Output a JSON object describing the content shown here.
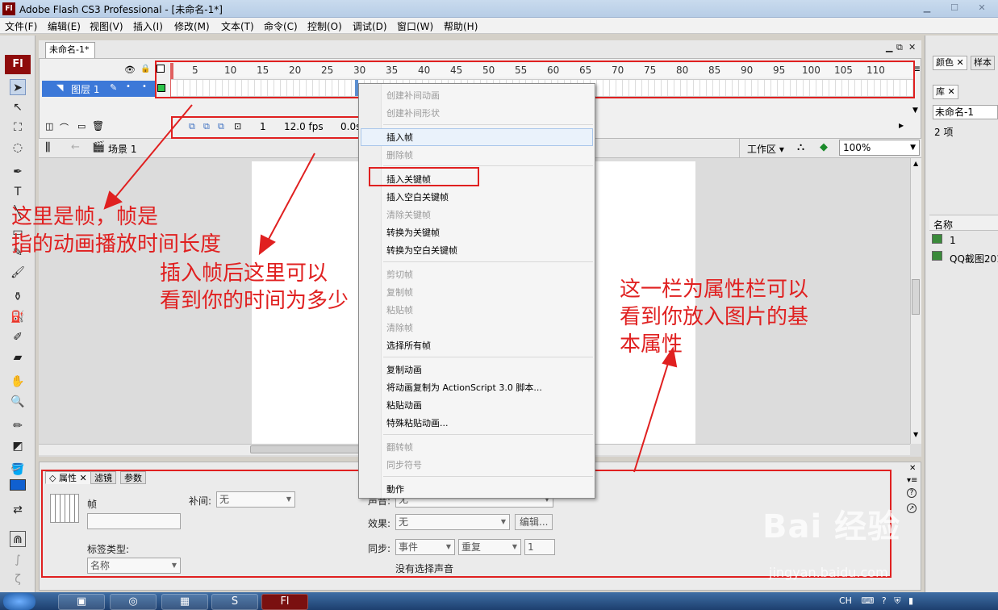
{
  "window": {
    "app_icon": "Fl",
    "title": "Adobe Flash CS3 Professional - [未命名-1*]"
  },
  "menu": [
    "文件(F)",
    "编辑(E)",
    "视图(V)",
    "插入(I)",
    "修改(M)",
    "文本(T)",
    "命令(C)",
    "控制(O)",
    "调试(D)",
    "窗口(W)",
    "帮助(H)"
  ],
  "document_tab": "未命名-1*",
  "timeline": {
    "layer_name": "图层 1",
    "ruler_ticks": [
      "5",
      "10",
      "15",
      "20",
      "25",
      "30",
      "35",
      "40",
      "45",
      "50",
      "55",
      "60",
      "65",
      "70",
      "75",
      "80",
      "85",
      "90",
      "95",
      "100",
      "105",
      "110"
    ],
    "current_frame": "1",
    "fps": "12.0 fps",
    "elapsed": "0.0s"
  },
  "scene": {
    "label": "场景 1",
    "workspace": "工作区",
    "zoom": "100%"
  },
  "properties": {
    "tabs": [
      "属性",
      "滤镜",
      "参数"
    ],
    "frame_label": "帧",
    "tween_label": "补间:",
    "tween_value": "无",
    "label_type_label": "标签类型:",
    "label_type_value": "名称",
    "sound_label": "声音:",
    "sound_value": "无",
    "effect_label": "效果:",
    "effect_value": "无",
    "edit_button": "编辑...",
    "sync_label": "同步:",
    "sync_value": "事件",
    "repeat_value": "重复",
    "repeat_count": "1",
    "no_sound": "没有选择声音"
  },
  "right_panel": {
    "tabs": [
      "颜色",
      "样本"
    ],
    "library_tab": "库",
    "library_doc": "未命名-1",
    "item_count": "2 项",
    "name_header": "名称",
    "items": [
      "1",
      "QQ截图201"
    ]
  },
  "context_menu": [
    {
      "label": "创建补间动画",
      "disabled": true
    },
    {
      "label": "创建补间形状",
      "disabled": true
    },
    {
      "label": "插入帧",
      "disabled": false
    },
    {
      "label": "删除帧",
      "disabled": true
    },
    {
      "label": "插入关键帧",
      "disabled": false
    },
    {
      "label": "插入空白关键帧",
      "disabled": false
    },
    {
      "label": "清除关键帧",
      "disabled": true
    },
    {
      "label": "转换为关键帧",
      "disabled": false
    },
    {
      "label": "转换为空白关键帧",
      "disabled": false
    },
    {
      "label": "剪切帧",
      "disabled": true
    },
    {
      "label": "复制帧",
      "disabled": true
    },
    {
      "label": "粘贴帧",
      "disabled": true
    },
    {
      "label": "清除帧",
      "disabled": true
    },
    {
      "label": "选择所有帧",
      "disabled": false
    },
    {
      "label": "复制动画",
      "disabled": false
    },
    {
      "label": "将动画复制为 ActionScript 3.0 脚本...",
      "disabled": false
    },
    {
      "label": "粘贴动画",
      "disabled": false
    },
    {
      "label": "特殊粘贴动画...",
      "disabled": false
    },
    {
      "label": "翻转帧",
      "disabled": true
    },
    {
      "label": "同步符号",
      "disabled": true
    },
    {
      "label": "動作",
      "disabled": false
    }
  ],
  "annotations": {
    "frames_note": "这里是帧，帧是\n指的动画播放时间长度",
    "time_note": "插入帧后这里可以\n看到你的时间为多少",
    "props_note": "这一栏为属性栏可以\n看到你放入图片的基\n本属性",
    "color": "#e02020"
  },
  "taskbar": {
    "tray_lang": "CH"
  },
  "watermark": {
    "brand": "Bai 经验",
    "url": "jingyan.baidu.com"
  }
}
